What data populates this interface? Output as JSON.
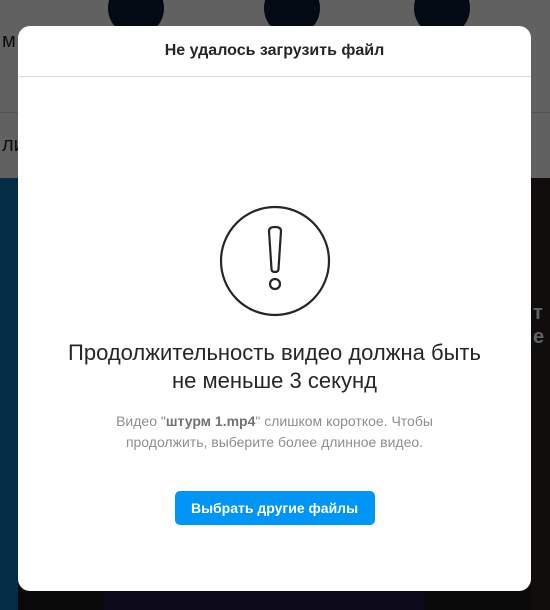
{
  "background": {
    "left_partial_text": [
      "м",
      "ли"
    ],
    "right_partial_text": [
      "т",
      "е"
    ]
  },
  "modal": {
    "title": "Не удалось загрузить файл",
    "icon": "exclamation-circle-icon",
    "message_line1": "Продолжительность видео должна быть",
    "message_line2": "не меньше 3 секунд",
    "detail_prefix": "Видео \"",
    "file_name": "штурм 1.mp4",
    "detail_suffix": "\" слишком короткое. Чтобы продолжить, выберите более длинное видео.",
    "button_label": "Выбрать другие файлы"
  },
  "colors": {
    "accent": "#0095f6",
    "overlay": "rgba(0,0,0,0.62)",
    "text_primary": "#262626",
    "text_secondary": "#8e8e8e"
  }
}
